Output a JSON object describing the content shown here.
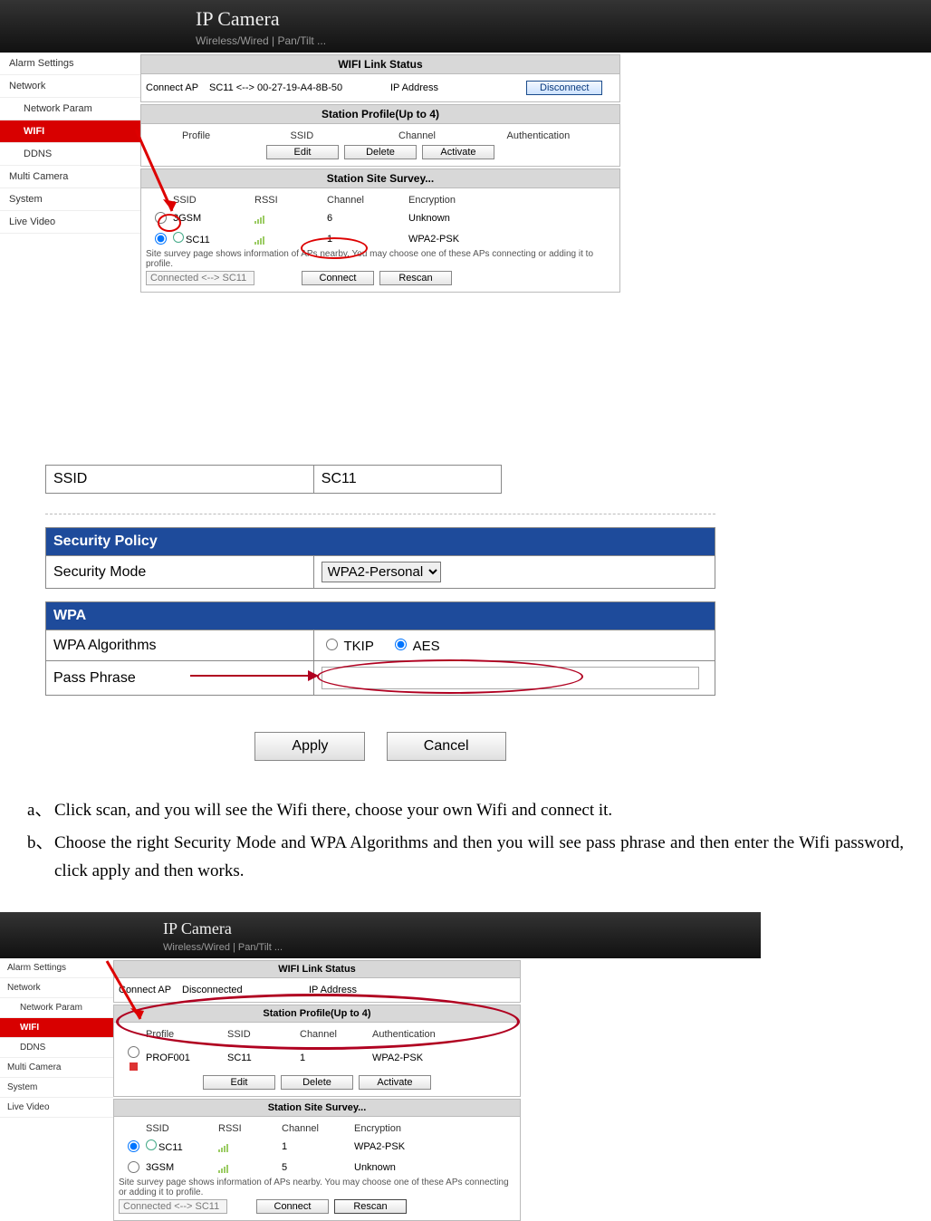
{
  "shot1": {
    "header": {
      "title": "IP Camera",
      "subtitle": "Wireless/Wired  |  Pan/Tilt  ..."
    },
    "sidebar": {
      "items": [
        {
          "label": "Alarm Settings"
        },
        {
          "label": "Network"
        },
        {
          "label": "Network Param",
          "sub": true
        },
        {
          "label": "WIFI",
          "sub": true,
          "active": true
        },
        {
          "label": "DDNS",
          "sub": true
        },
        {
          "label": "Multi Camera"
        },
        {
          "label": "System"
        },
        {
          "label": "Live Video"
        }
      ]
    },
    "link_status": {
      "title": "WIFI Link Status",
      "connect_ap_label": "Connect AP",
      "connect_ap_value": "SC11 <--> 00-27-19-A4-8B-50",
      "ip_label": "IP Address",
      "disconnect": "Disconnect"
    },
    "profile": {
      "title": "Station Profile(Up to 4)",
      "cols": {
        "profile": "Profile",
        "ssid": "SSID",
        "channel": "Channel",
        "auth": "Authentication"
      },
      "buttons": {
        "edit": "Edit",
        "delete": "Delete",
        "activate": "Activate"
      }
    },
    "survey": {
      "title": "Station Site Survey...",
      "cols": {
        "ssid": "SSID",
        "rssi": "RSSI",
        "channel": "Channel",
        "encryption": "Encryption"
      },
      "rows": [
        {
          "ssid": "3GSM",
          "channel": "6",
          "encryption": "Unknown"
        },
        {
          "ssid": "SC11",
          "channel": "1",
          "encryption": "WPA2-PSK"
        }
      ],
      "note": "Site survey page shows information of APs nearby. You may choose one of these APs connecting or adding it to profile.",
      "status_value": "Connected <--> SC11",
      "connect": "Connect",
      "rescan": "Rescan"
    }
  },
  "security": {
    "ssid_label": "SSID",
    "ssid_value": "SC11",
    "policy_header": "Security Policy",
    "mode_label": "Security Mode",
    "mode_value": "WPA2-Personal",
    "wpa_header": "WPA",
    "algo_label": "WPA Algorithms",
    "algo_tkip": "TKIP",
    "algo_aes": "AES",
    "pass_label": "Pass Phrase",
    "apply": "Apply",
    "cancel": "Cancel"
  },
  "instructions": {
    "a": "Click scan, and you will see the Wifi there, choose your own Wifi and connect it.",
    "b": "Choose the right Security Mode and WPA Algorithms and then you will see pass phrase and then enter the Wifi password, click apply and then works."
  },
  "shot2": {
    "header": {
      "title": "IP Camera",
      "subtitle": "Wireless/Wired  |  Pan/Tilt  ..."
    },
    "sidebar": {
      "items": [
        {
          "label": "Alarm Settings"
        },
        {
          "label": "Network"
        },
        {
          "label": "Network Param",
          "sub": true
        },
        {
          "label": "WIFI",
          "sub": true,
          "active": true
        },
        {
          "label": "DDNS",
          "sub": true
        },
        {
          "label": "Multi Camera"
        },
        {
          "label": "System"
        },
        {
          "label": "Live Video"
        }
      ]
    },
    "link_status": {
      "title": "WIFI Link Status",
      "connect_ap_label": "Connect AP",
      "connect_ap_value": "Disconnected",
      "ip_label": "IP Address"
    },
    "profile": {
      "title": "Station Profile(Up to 4)",
      "cols": {
        "profile": "Profile",
        "ssid": "SSID",
        "channel": "Channel",
        "auth": "Authentication"
      },
      "row": {
        "profile": "PROF001",
        "ssid": "SC11",
        "channel": "1",
        "auth": "WPA2-PSK"
      },
      "buttons": {
        "edit": "Edit",
        "delete": "Delete",
        "activate": "Activate"
      }
    },
    "survey": {
      "title": "Station Site Survey...",
      "cols": {
        "ssid": "SSID",
        "rssi": "RSSI",
        "channel": "Channel",
        "encryption": "Encryption"
      },
      "rows": [
        {
          "ssid": "SC11",
          "channel": "1",
          "encryption": "WPA2-PSK"
        },
        {
          "ssid": "3GSM",
          "channel": "5",
          "encryption": "Unknown"
        }
      ],
      "note": "Site survey page shows information of APs nearby. You may choose one of these APs connecting or adding it to profile.",
      "status_value": "Connected <--> SC11",
      "connect": "Connect",
      "rescan": "Rescan"
    }
  }
}
